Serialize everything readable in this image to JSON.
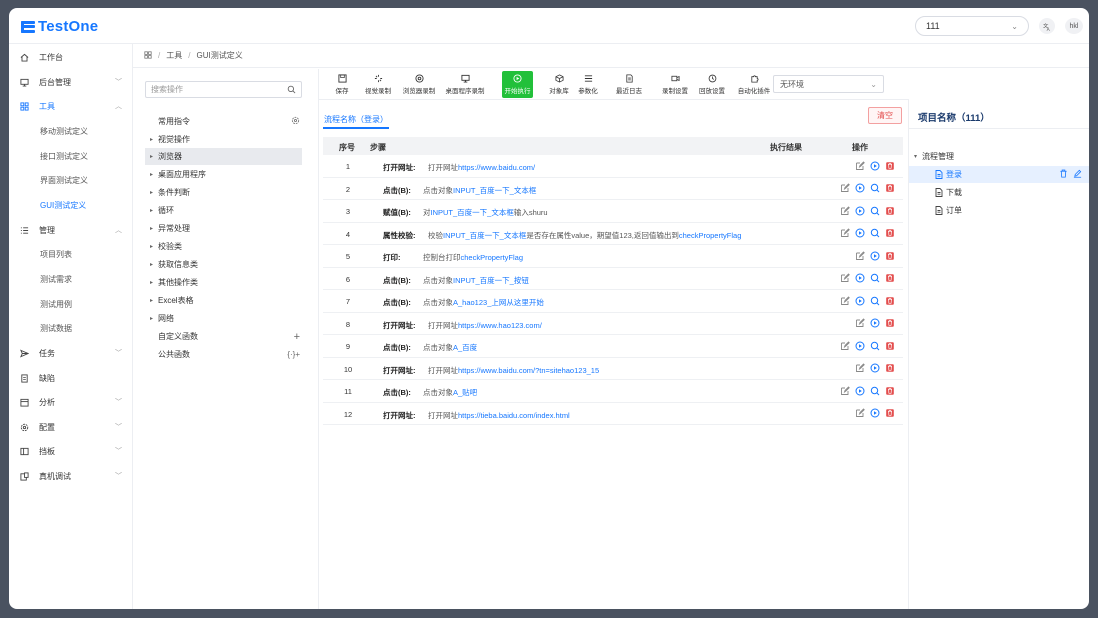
{
  "app": {
    "name": "TestOne"
  },
  "header": {
    "project": "111",
    "user": "hkl"
  },
  "sidebar": {
    "items": [
      {
        "label": "工作台",
        "icon": "home-icon"
      },
      {
        "label": "后台管理",
        "icon": "monitor-icon",
        "chevron": "﹀"
      },
      {
        "label": "工具",
        "icon": "grid-icon",
        "chevron": "︿"
      },
      {
        "label": "移动测试定义"
      },
      {
        "label": "接口测试定义"
      },
      {
        "label": "界面测试定义"
      },
      {
        "label": "GUI测试定义"
      },
      {
        "label": "管理",
        "icon": "list-icon",
        "chevron": "︿"
      },
      {
        "label": "项目列表"
      },
      {
        "label": "测试需求"
      },
      {
        "label": "测试用例"
      },
      {
        "label": "测试数据"
      },
      {
        "label": "任务",
        "icon": "send-icon",
        "chevron": "﹀"
      },
      {
        "label": "缺陷",
        "icon": "bug-icon"
      },
      {
        "label": "分析",
        "icon": "calendar-icon",
        "chevron": "﹀"
      },
      {
        "label": "配置",
        "icon": "gear-icon",
        "chevron": "﹀"
      },
      {
        "label": "挡板",
        "icon": "panel-icon",
        "chevron": "﹀"
      },
      {
        "label": "真机调试",
        "icon": "device-icon",
        "chevron": "﹀"
      }
    ]
  },
  "breadcrumb": {
    "sep": "/",
    "items": [
      "工具",
      "GUI测试定义"
    ]
  },
  "ops": {
    "search_placeholder": "搜索操作",
    "items": [
      {
        "label": "常用指令",
        "arrow": ""
      },
      {
        "label": "视觉操作",
        "arrow": "▸"
      },
      {
        "label": "浏览器",
        "arrow": "▸"
      },
      {
        "label": "桌面应用程序",
        "arrow": "▸"
      },
      {
        "label": "条件判断",
        "arrow": "▸"
      },
      {
        "label": "循环",
        "arrow": "▸"
      },
      {
        "label": "异常处理",
        "arrow": "▸"
      },
      {
        "label": "校验类",
        "arrow": "▸"
      },
      {
        "label": "获取信息类",
        "arrow": "▸"
      },
      {
        "label": "其他操作类",
        "arrow": "▸"
      },
      {
        "label": "Excel表格",
        "arrow": "▸"
      },
      {
        "label": "网络",
        "arrow": "▸"
      },
      {
        "label": "自定义函数",
        "arrow": ""
      },
      {
        "label": "公共函数",
        "arrow": ""
      }
    ],
    "fn_add": "+",
    "public_fn_icons": "{·}+"
  },
  "toolbar": {
    "buttons": [
      {
        "label": "保存",
        "icon": "save-icon"
      },
      {
        "label": "视觉录制",
        "icon": "eye-record-icon"
      },
      {
        "label": "浏览器录制",
        "icon": "browser-icon"
      },
      {
        "label": "桌面程序录制",
        "icon": "desktop-icon"
      },
      {
        "label": "开始执行",
        "icon": "play-icon"
      },
      {
        "label": "对象库",
        "icon": "cube-icon"
      },
      {
        "label": "参数化",
        "icon": "list-icon"
      },
      {
        "label": "最近日志",
        "icon": "file-icon"
      },
      {
        "label": "录制设置",
        "icon": "video-icon"
      },
      {
        "label": "回放设置",
        "icon": "replay-icon"
      },
      {
        "label": "自动化插件",
        "icon": "puzzle-icon"
      }
    ],
    "env": "无环境"
  },
  "tabs": {
    "active": "流程名称（登录）",
    "clear": "清空"
  },
  "table": {
    "headers": {
      "index": "序号",
      "step": "步骤",
      "result": "执行结果",
      "actions": "操作"
    },
    "rows": [
      {
        "n": "1",
        "kw": "打开网址:",
        "pre": "打开网址",
        "link": "https://www.baidu.com/",
        "post": "",
        "inspect": false
      },
      {
        "n": "2",
        "kw": "点击(B):",
        "pre": "点击对象",
        "link": "INPUT_百度一下_文本框",
        "post": "",
        "inspect": true
      },
      {
        "n": "3",
        "kw": "赋值(B):",
        "pre": "对",
        "link": "INPUT_百度一下_文本框",
        "post": "输入shuru",
        "inspect": true
      },
      {
        "n": "4",
        "kw": "属性校验:",
        "pre": "校验",
        "link": "INPUT_百度一下_文本框",
        "post": "是否存在属性value，期望值123,返回值输出到",
        "link2": "checkPropertyFlag",
        "inspect": true
      },
      {
        "n": "5",
        "kw": "打印:",
        "pre": "控制台打印",
        "link": "checkPropertyFlag",
        "post": "",
        "inspect": false
      },
      {
        "n": "6",
        "kw": "点击(B):",
        "pre": "点击对象",
        "link": "INPUT_百度一下_按钮",
        "post": "",
        "inspect": true
      },
      {
        "n": "7",
        "kw": "点击(B):",
        "pre": "点击对象",
        "link": "A_hao123_上网从这里开始",
        "post": "",
        "inspect": true
      },
      {
        "n": "8",
        "kw": "打开网址:",
        "pre": "打开网址",
        "link": "https://www.hao123.com/",
        "post": "",
        "inspect": false
      },
      {
        "n": "9",
        "kw": "点击(B):",
        "pre": "点击对象",
        "link": "A_百度",
        "post": "",
        "inspect": true
      },
      {
        "n": "10",
        "kw": "打开网址:",
        "pre": "打开网址",
        "link": "https://www.baidu.com/?tn=sitehao123_15",
        "post": "",
        "inspect": false
      },
      {
        "n": "11",
        "kw": "点击(B):",
        "pre": "点击对象",
        "link": "A_贴吧",
        "post": "",
        "inspect": true
      },
      {
        "n": "12",
        "kw": "打开网址:",
        "pre": "打开网址",
        "link": "https://tieba.baidu.com/index.html",
        "post": "",
        "inspect": false
      }
    ]
  },
  "project_panel": {
    "title": "项目名称（111）",
    "tree": [
      {
        "label": "流程管理",
        "arrow": "▾"
      },
      {
        "label": "登录",
        "selected": true
      },
      {
        "label": "下载"
      },
      {
        "label": "订单"
      }
    ]
  },
  "colors": {
    "accent": "#1677ff",
    "run": "#22c03a",
    "danger": "#e34d4d"
  }
}
